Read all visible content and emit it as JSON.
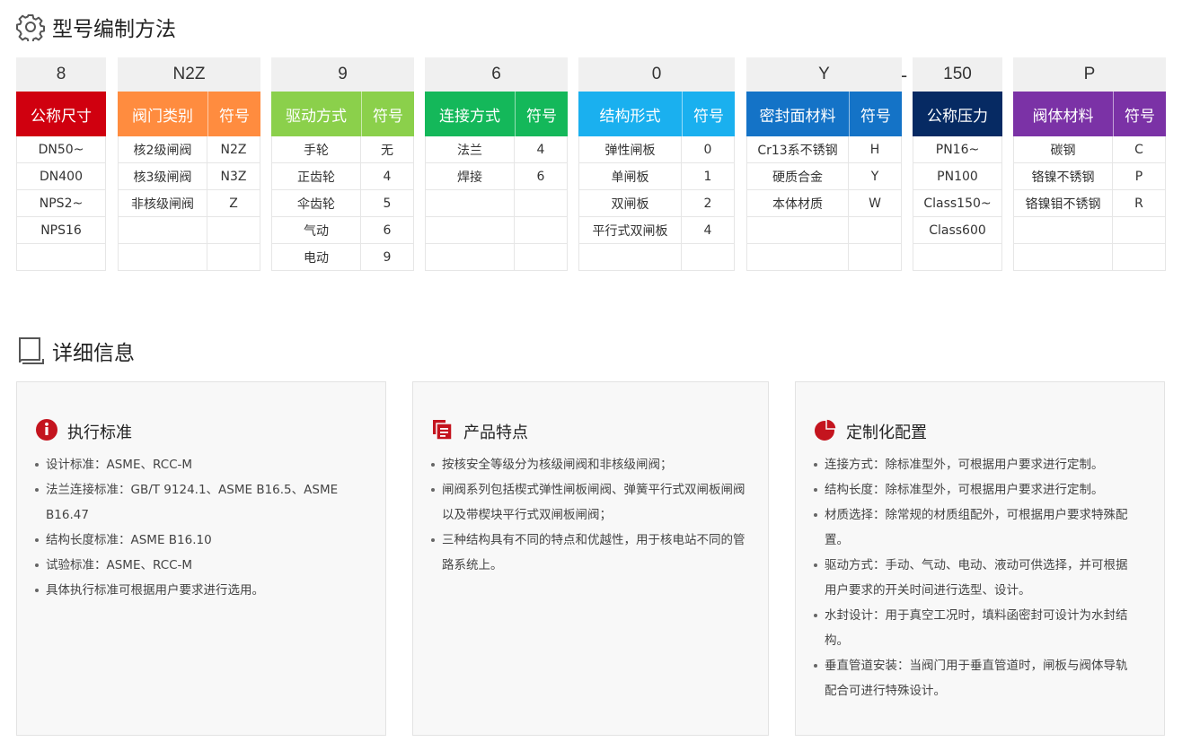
{
  "section1": {
    "title": "型号编制方法"
  },
  "section2": {
    "title": "详细信息"
  },
  "separator": "-",
  "colors": {
    "red": "#d0000f",
    "orange": "#ff8c3f",
    "green_light": "#8bd04b",
    "green": "#14b85a",
    "cyan": "#1ab0ef",
    "blue": "#1473c7",
    "navy": "#062a63",
    "purple": "#7b32a6",
    "code_bg": "#f0f0f0",
    "card_bg": "#f8f8f8"
  },
  "groups": [
    {
      "code": "8",
      "header": "公称尺寸",
      "color": "#d0000f",
      "split": false,
      "rows": [
        [
          "DN50~"
        ],
        [
          "DN400"
        ],
        [
          "NPS2~"
        ],
        [
          "NPS16"
        ],
        [
          ""
        ]
      ]
    },
    {
      "code": "N2Z",
      "header": "阀门类别",
      "symbol_header": "符号",
      "color": "#ff8c3f",
      "split": true,
      "rows": [
        [
          "核2级闸阀",
          "N2Z"
        ],
        [
          "核3级闸阀",
          "N3Z"
        ],
        [
          "非核级闸阀",
          "Z"
        ],
        [
          "",
          ""
        ],
        [
          "",
          ""
        ]
      ]
    },
    {
      "code": "9",
      "header": "驱动方式",
      "symbol_header": "符号",
      "color": "#8bd04b",
      "split": true,
      "rows": [
        [
          "手轮",
          "无"
        ],
        [
          "正齿轮",
          "4"
        ],
        [
          "伞齿轮",
          "5"
        ],
        [
          "气动",
          "6"
        ],
        [
          "电动",
          "9"
        ]
      ]
    },
    {
      "code": "6",
      "header": "连接方式",
      "symbol_header": "符号",
      "color": "#14b85a",
      "split": true,
      "rows": [
        [
          "法兰",
          "4"
        ],
        [
          "焊接",
          "6"
        ],
        [
          "",
          ""
        ],
        [
          "",
          ""
        ],
        [
          "",
          ""
        ]
      ]
    },
    {
      "code": "0",
      "header": "结构形式",
      "symbol_header": "符号",
      "color": "#1ab0ef",
      "split": true,
      "rows": [
        [
          "弹性闸板",
          "0"
        ],
        [
          "单闸板",
          "1"
        ],
        [
          "双闸板",
          "2"
        ],
        [
          "平行式双闸板",
          "4"
        ],
        [
          "",
          ""
        ]
      ]
    },
    {
      "code": "Y",
      "header": "密封面材料",
      "symbol_header": "符号",
      "color": "#1473c7",
      "split": true,
      "rows": [
        [
          "Cr13系不锈钢",
          "H"
        ],
        [
          "硬质合金",
          "Y"
        ],
        [
          "本体材质",
          "W"
        ],
        [
          "",
          ""
        ],
        [
          "",
          ""
        ]
      ]
    },
    {
      "code": "150",
      "header": "公称压力",
      "color": "#062a63",
      "split": false,
      "rows": [
        [
          "PN16~"
        ],
        [
          "PN100"
        ],
        [
          "Class150~"
        ],
        [
          "Class600"
        ],
        [
          ""
        ]
      ]
    },
    {
      "code": "P",
      "header": "阀体材料",
      "symbol_header": "符号",
      "color": "#7b32a6",
      "split": true,
      "rows": [
        [
          "碳钢",
          "C"
        ],
        [
          "铬镍不锈钢",
          "P"
        ],
        [
          "铬镍钼不锈钢",
          "R"
        ],
        [
          "",
          ""
        ],
        [
          "",
          ""
        ]
      ]
    }
  ],
  "cards": [
    {
      "title": "执行标准",
      "icon": "info-icon",
      "items": [
        "设计标准：ASME、RCC-M",
        "法兰连接标准：GB/T 9124.1、ASME B16.5、ASME B16.47",
        "结构长度标准：ASME B16.10",
        "试验标准：ASME、RCC-M",
        "具体执行标准可根据用户要求进行选用。"
      ]
    },
    {
      "title": "产品特点",
      "icon": "document-icon",
      "items": [
        "按核安全等级分为核级闸阀和非核级闸阀；",
        "闸阀系列包括楔式弹性闸板闸阀、弹簧平行式双闸板闸阀以及带楔块平行式双闸板闸阀；",
        "三种结构具有不同的特点和优越性，用于核电站不同的管路系统上。"
      ]
    },
    {
      "title": "定制化配置",
      "icon": "pie-chart-icon",
      "items": [
        "连接方式：除标准型外，可根据用户要求进行定制。",
        "结构长度：除标准型外，可根据用户要求进行定制。",
        "材质选择：除常规的材质组配外，可根据用户要求特殊配置。",
        "驱动方式：手动、气动、电动、液动可供选择，并可根据用户要求的开关时间进行选型、设计。",
        "水封设计：用于真空工况时，填料函密封可设计为水封结构。",
        "垂直管道安装：当阀门用于垂直管道时，闸板与阀体导轨配合可进行特殊设计。"
      ]
    }
  ]
}
